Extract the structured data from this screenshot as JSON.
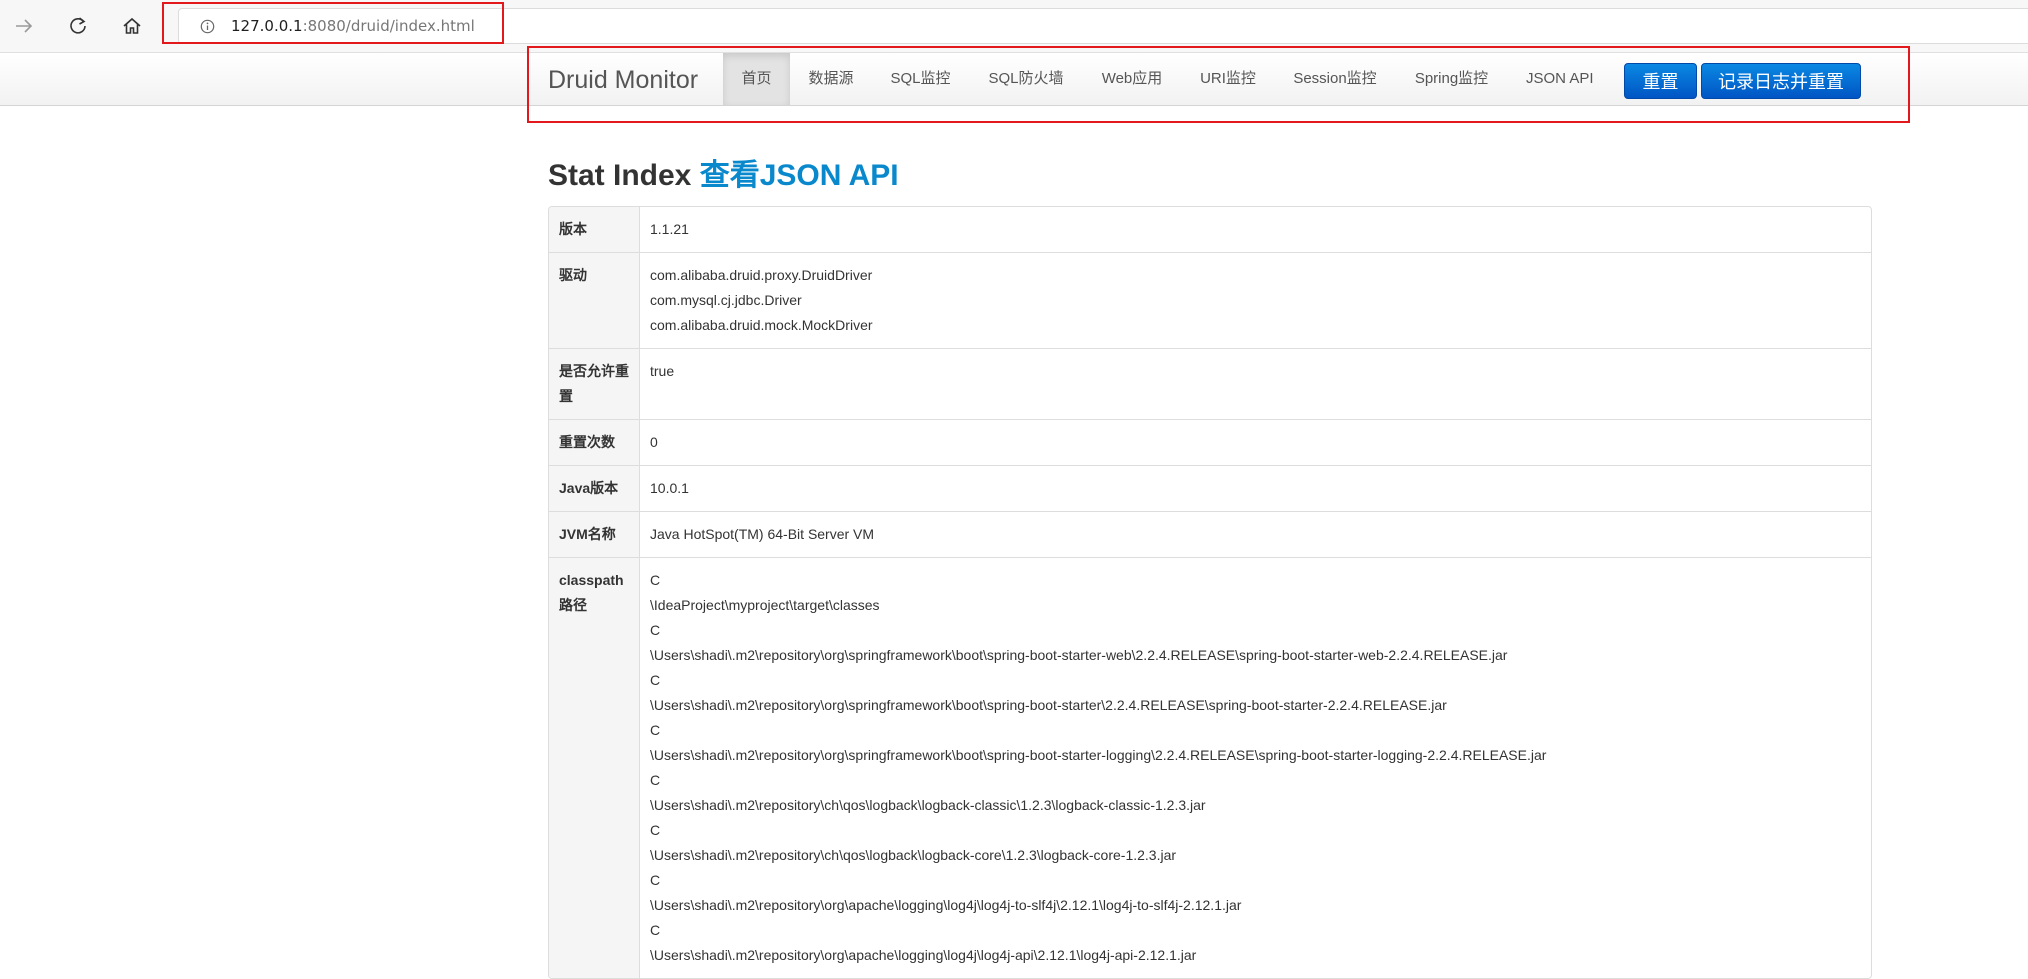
{
  "browser": {
    "url_host": "127.0.0.1",
    "url_path": ":8080/druid/index.html"
  },
  "navbar": {
    "brand": "Druid Monitor",
    "items": [
      "首页",
      "数据源",
      "SQL监控",
      "SQL防火墙",
      "Web应用",
      "URI监控",
      "Session监控",
      "Spring监控",
      "JSON API"
    ],
    "active_item": "首页",
    "reset_button": "重置",
    "log_reset_button": "记录日志并重置"
  },
  "page": {
    "title": "Stat Index",
    "title_link": "查看JSON API"
  },
  "stats": {
    "version_label": "版本",
    "version": "1.1.21",
    "drivers_label": "驱动",
    "drivers": [
      "com.alibaba.druid.proxy.DruidDriver",
      "com.mysql.cj.jdbc.Driver",
      "com.alibaba.druid.mock.MockDriver"
    ],
    "reset_enable_label": "是否允许重置",
    "reset_enable": "true",
    "reset_count_label": "重置次数",
    "reset_count": "0",
    "java_version_label": "Java版本",
    "java_version": "10.0.1",
    "jvm_name_label": "JVM名称",
    "jvm_name": "Java HotSpot(TM) 64-Bit Server VM",
    "classpath_label": "classpath路径",
    "classpath": [
      "C",
      "\\IdeaProject\\myproject\\target\\classes",
      "C",
      "\\Users\\shadi\\.m2\\repository\\org\\springframework\\boot\\spring-boot-starter-web\\2.2.4.RELEASE\\spring-boot-starter-web-2.2.4.RELEASE.jar",
      "C",
      "\\Users\\shadi\\.m2\\repository\\org\\springframework\\boot\\spring-boot-starter\\2.2.4.RELEASE\\spring-boot-starter-2.2.4.RELEASE.jar",
      "C",
      "\\Users\\shadi\\.m2\\repository\\org\\springframework\\boot\\spring-boot-starter-logging\\2.2.4.RELEASE\\spring-boot-starter-logging-2.2.4.RELEASE.jar",
      "C",
      "\\Users\\shadi\\.m2\\repository\\ch\\qos\\logback\\logback-classic\\1.2.3\\logback-classic-1.2.3.jar",
      "C",
      "\\Users\\shadi\\.m2\\repository\\ch\\qos\\logback\\logback-core\\1.2.3\\logback-core-1.2.3.jar",
      "C",
      "\\Users\\shadi\\.m2\\repository\\org\\apache\\logging\\log4j\\log4j-to-slf4j\\2.12.1\\log4j-to-slf4j-2.12.1.jar",
      "C",
      "\\Users\\shadi\\.m2\\repository\\org\\apache\\logging\\log4j\\log4j-api\\2.12.1\\log4j-api-2.12.1.jar"
    ]
  },
  "colors": {
    "highlight_border": "#e3181c",
    "primary_button": "#0a6fd6",
    "title_link": "#0a88cc"
  }
}
